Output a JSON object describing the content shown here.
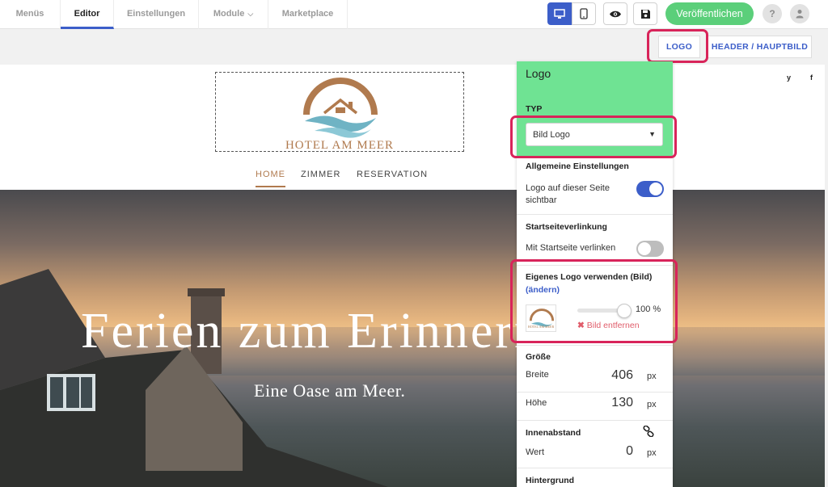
{
  "topbar": {
    "tabs": [
      {
        "label": "Menüs"
      },
      {
        "label": "Editor"
      },
      {
        "label": "Einstellungen"
      },
      {
        "label": "Module"
      },
      {
        "label": "Marketplace"
      }
    ],
    "publish_label": "Veröffentlichen",
    "help_label": "?"
  },
  "subbar": {
    "logo_label": "LOGO",
    "header_label": "HEADER / HAUPTBILD"
  },
  "site": {
    "logo_text": "HOTEL AM MEER",
    "nav": [
      "HOME",
      "ZIMMER",
      "RESERVATION"
    ],
    "social": [
      "y",
      "f"
    ],
    "hero_title": "Ferien zum Erinnern",
    "hero_subtitle": "Eine Oase am Meer."
  },
  "panel": {
    "title": "Logo",
    "typ_label": "TYP",
    "typ_value": "Bild Logo",
    "general_title": "Allgemeine Einstellungen",
    "logo_visible_label": "Logo auf dieser Seite sichtbar",
    "logo_visible_on": true,
    "homelink_title": "Startseiteverlinkung",
    "homelink_label": "Mit Startseite verlinken",
    "homelink_on": false,
    "own_logo_title": "Eigenes Logo verwenden (Bild)",
    "change_link": "(ändern)",
    "thumb_text": "HOTEL AM MEER",
    "scale_value": "100 %",
    "remove_label": "Bild entfernen",
    "size_title": "Größe",
    "width_label": "Breite",
    "width_value": "406",
    "height_label": "Höhe",
    "height_value": "130",
    "unit": "px",
    "padding_title": "Innenabstand",
    "padding_label": "Wert",
    "padding_value": "0",
    "background_title": "Hintergrund"
  },
  "colors": {
    "accent": "#3c5ec9",
    "publish": "#5bcf7a",
    "panel_header": "#6fe393",
    "highlight": "#d8245a",
    "brand": "#b07a4e"
  }
}
